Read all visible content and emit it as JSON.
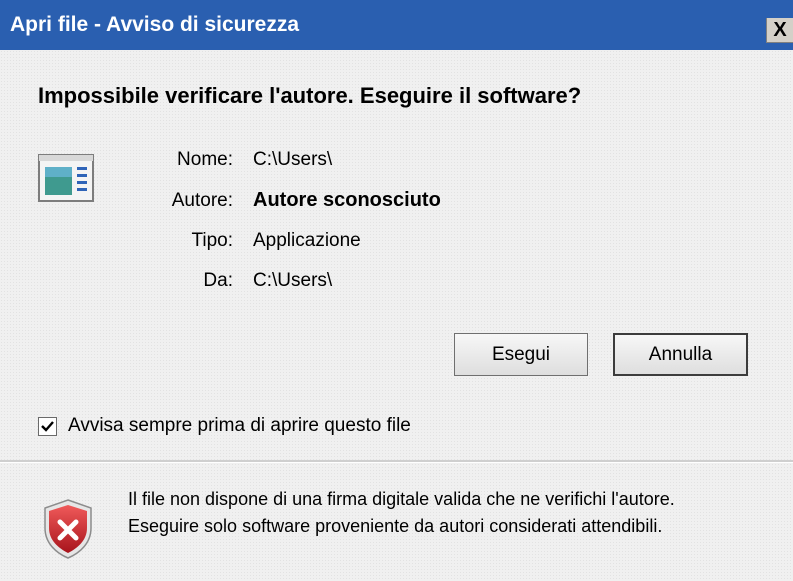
{
  "window": {
    "title": "Apri file - Avviso di sicurezza",
    "close_label": "X"
  },
  "dialog": {
    "question": "Impossibile verificare l'autore. Eseguire il software?",
    "icon": "application-file-icon",
    "properties": [
      {
        "label": "Nome:",
        "value": "C:\\Users\\"
      },
      {
        "label": "Autore:",
        "value": "Autore sconosciuto"
      },
      {
        "label": "Tipo:",
        "value": "Applicazione"
      },
      {
        "label": "Da:",
        "value": "C:\\Users\\"
      }
    ],
    "buttons": {
      "run_label": "Esegui",
      "cancel_label": "Annulla"
    },
    "checkbox": {
      "label": "Avvisa sempre prima di aprire questo file",
      "checked": true
    }
  },
  "footer": {
    "icon": "security-warning-shield-icon",
    "line1": "Il file non dispone di una firma digitale valida che ne verifichi l'autore.",
    "line2": "Eseguire solo software proveniente da autori considerati attendibili."
  },
  "colors": {
    "titlebar": "#2a5fb0",
    "shield_red": "#c8202a"
  }
}
